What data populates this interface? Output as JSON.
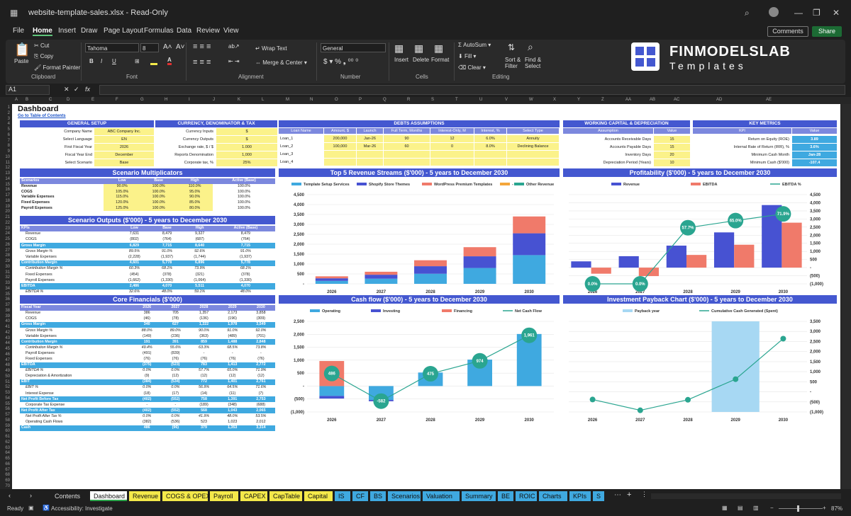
{
  "window": {
    "title": "website-template-sales.xlsx  -  Read-Only",
    "comments": "Comments",
    "share": "Share"
  },
  "menu": [
    "File",
    "Home",
    "Insert",
    "Draw",
    "Page Layout",
    "Formulas",
    "Data",
    "Review",
    "View"
  ],
  "ribbon": {
    "cut": "Cut",
    "copy": "Copy",
    "format_painter": "Format Painter",
    "paste": "Paste",
    "clipboard": "Clipboard",
    "font_name": "Tahoma",
    "font_size": "8",
    "font": "Font",
    "wrap_text": "Wrap Text",
    "merge_center": "Merge & Center",
    "alignment": "Alignment",
    "number_format": "General",
    "number": "Number",
    "insert": "Insert",
    "delete": "Delete",
    "format": "Format",
    "cells": "Cells",
    "autosum": "AutoSum",
    "fill": "Fill",
    "clear": "Clear",
    "sort_filter": "Sort & Filter",
    "find_select": "Find & Select",
    "editing": "Editing",
    "logo_line1": "FINMODELSLAB",
    "logo_line2": "Templates"
  },
  "formula_bar": {
    "cell_ref": "A1",
    "fx": "fx"
  },
  "columns": [
    "A",
    "B",
    "C",
    "D",
    "E",
    "F",
    "G",
    "H",
    "I",
    "J",
    "K",
    "L",
    "M",
    "N",
    "O",
    "P",
    "Q",
    "R",
    "S",
    "T",
    "U",
    "V",
    "W",
    "X",
    "Y",
    "Z",
    "AA",
    "AB",
    "AC",
    "AD",
    "AE"
  ],
  "sheet": {
    "title": "Dashboard",
    "toc": "Go to Table of Contents",
    "general": {
      "header": "GENERAL SETUP",
      "rows": [
        [
          "Company Name",
          "ABC Company Inc."
        ],
        [
          "Select Language",
          "EN"
        ],
        [
          "First Fiscal Year",
          "2026"
        ],
        [
          "Fiscal Year End",
          "December"
        ],
        [
          "Select Scenario",
          "Base"
        ]
      ]
    },
    "currency": {
      "header": "CURRENCY, DENOMINATOR & TAX",
      "rows": [
        [
          "Currency Inputs",
          "$"
        ],
        [
          "Currency Outputs",
          "$"
        ],
        [
          "Exchange rate, $ / $",
          "1.000"
        ],
        [
          "Reports Denomination",
          "1,000"
        ],
        [
          "Corporate tax, %",
          "25%"
        ]
      ]
    },
    "debts": {
      "header": "DEBTS ASSUMPTIONS",
      "cols": [
        "Loan Name",
        "Amount, $",
        "Launch",
        "Full Term, Months",
        "Interest-Only, M",
        "Interest, %",
        "Select Type"
      ],
      "rows": [
        [
          "Loan_1",
          "200,000",
          "Jan-26",
          "90",
          "12",
          "6.0%",
          "Annuity"
        ],
        [
          "Loan_2",
          "100,000",
          "Mar-26",
          "60",
          "0",
          "8.0%",
          "Declining Balance"
        ],
        [
          "Loan_3",
          "",
          "",
          "",
          "",
          "",
          ""
        ],
        [
          "Loan_4",
          "",
          "",
          "",
          "",
          "",
          ""
        ]
      ]
    },
    "wc": {
      "header": "WORKING CAPITAL & DEPRECIATION",
      "cols": [
        "Assumption",
        "Value"
      ],
      "rows": [
        [
          "Accounts Receivable Days",
          "15"
        ],
        [
          "Accounts Payable Days",
          "15"
        ],
        [
          "Inventory Days",
          "20"
        ],
        [
          "Depreciation Period (Years)",
          "10"
        ]
      ]
    },
    "kpi": {
      "header": "KEY METRICS",
      "cols": [
        "KPI",
        "Value"
      ],
      "rows": [
        [
          "Return on Equity (ROE)",
          "3.89"
        ],
        [
          "Internal Rate of Return (IRR), %",
          "3.6%"
        ],
        [
          "Minimum Cash Month",
          "Jan-28"
        ],
        [
          "Minimum Cash ($'000)",
          "-107.4"
        ]
      ]
    },
    "scen_mult": {
      "header": "Scenario Multiplicators",
      "cols": [
        "Scenarios",
        "Low",
        "Base",
        "High",
        "Active (Base)"
      ],
      "rows": [
        [
          "Revenue",
          "90.0%",
          "100.0%",
          "110.0%",
          "100.0%"
        ],
        [
          "COGS",
          "105.0%",
          "100.0%",
          "95.0%",
          "100.0%"
        ],
        [
          "Variable Expenses",
          "115.0%",
          "100.0%",
          "90.0%",
          "100.0%"
        ],
        [
          "Fixed Expenses",
          "120.0%",
          "100.0%",
          "85.0%",
          "100.0%"
        ],
        [
          "Payroll Expenses",
          "125.0%",
          "100.0%",
          "80.0%",
          "100.0%"
        ]
      ]
    },
    "scen_out": {
      "header": "Scenario Outputs ($'000) - 5 years to December 2030",
      "cols": [
        "KPIs",
        "Low",
        "Base",
        "High",
        "Active (Base)"
      ],
      "rows": [
        [
          "Revenue",
          "7,631",
          "8,479",
          "9,327",
          "8,479",
          ""
        ],
        [
          "COGS",
          "(802)",
          "(764)",
          "(687)",
          "(764)",
          ""
        ],
        [
          "Gross Margin",
          "6,829",
          "7,715",
          "8,640",
          "7,715",
          "hl"
        ],
        [
          "Gross Margin %",
          "89.5%",
          "91.0%",
          "92.6%",
          "91.0%",
          "it"
        ],
        [
          "Variable Expenses",
          "(2,228)",
          "(1,937)",
          "(1,744)",
          "(1,937)",
          ""
        ],
        [
          "Contribution Margin",
          "4,601",
          "5,778",
          "6,896",
          "5,778",
          "hl"
        ],
        [
          "Contribution Margin %",
          "60.3%",
          "68.1%",
          "73.9%",
          "68.1%",
          "it"
        ],
        [
          "Fixed Expenses",
          "(454)",
          "(378)",
          "(321)",
          "(378)",
          ""
        ],
        [
          "Payroll Expenses",
          "(1,662)",
          "(1,330)",
          "(1,064)",
          "(1,330)",
          ""
        ],
        [
          "EBITDA",
          "2,486",
          "4,070",
          "5,511",
          "4,070",
          "hl"
        ],
        [
          "EBITDA %",
          "32.6%",
          "48.0%",
          "59.1%",
          "48.0%",
          "it"
        ]
      ]
    },
    "core": {
      "header": "Core Financials ($'000)",
      "cols": [
        "Fiscal Year",
        "2026",
        "2027",
        "2028",
        "2029",
        "2030"
      ],
      "rows": [
        [
          "Revenue",
          "386",
          "705",
          "1,357",
          "2,173",
          "3,858",
          ""
        ],
        [
          "COGS",
          "(46)",
          "(78)",
          "(136)",
          "(196)",
          "(309)",
          ""
        ],
        [
          "Gross Margin",
          "340",
          "627",
          "1,222",
          "1,978",
          "3,549",
          "hl"
        ],
        [
          "Gross Margin %",
          "88.0%",
          "89.0%",
          "90.0%",
          "91.0%",
          "92.0%",
          "it"
        ],
        [
          "Variable Expenses",
          "(149)",
          "(236)",
          "(363)",
          "(489)",
          "(701)",
          ""
        ],
        [
          "Contribution Margin",
          "191",
          "391",
          "859",
          "1,488",
          "2,848",
          "hl"
        ],
        [
          "Contribution Margin %",
          "49.4%",
          "55.6%",
          "63.3%",
          "68.5%",
          "73.8%",
          "it"
        ],
        [
          "Payroll Expenses",
          "(491)",
          "(839)",
          "-",
          "-",
          "-",
          ""
        ],
        [
          "Fixed Expenses",
          "(76)",
          "(76)",
          "(76)",
          "(76)",
          "(76)",
          ""
        ],
        [
          "EBITDA",
          "(375)",
          "(523)",
          "783",
          "1,413",
          "2,772",
          "hl"
        ],
        [
          "EBITDA %",
          "0.0%",
          "0.0%",
          "57.7%",
          "65.0%",
          "71.9%",
          "it"
        ],
        [
          "Depreciation & Amortization",
          "(9)",
          "(12)",
          "(12)",
          "(12)",
          "(12)",
          ""
        ],
        [
          "EBIT",
          "(384)",
          "(534)",
          "772",
          "1,401",
          "2,761",
          "hl"
        ],
        [
          "EBIT %",
          "0.0%",
          "0.0%",
          "56.9%",
          "64.5%",
          "71.6%",
          "it"
        ],
        [
          "Interest Expense",
          "(18)",
          "(17)",
          "(14)",
          "(11)",
          "(7)",
          ""
        ],
        [
          "Net Profit Before Tax",
          "(402)",
          "(552)",
          "758",
          "1,391",
          "2,753",
          "hl"
        ],
        [
          "Corporate Tax Expense",
          "-",
          "-",
          "(189)",
          "(348)",
          "(688)",
          ""
        ],
        [
          "Net Profit After Tax",
          "(402)",
          "(552)",
          "568",
          "1,043",
          "2,065",
          "hl"
        ],
        [
          "Net Profit After Tax %",
          "0.0%",
          "0.0%",
          "41.9%",
          "48.0%",
          "53.5%",
          "it"
        ],
        [
          "Operating Cash Flows",
          "(382)",
          "(536)",
          "523",
          "1,023",
          "2,012",
          ""
        ],
        [
          "Cash",
          "486",
          "(96)",
          "379",
          "1,353",
          "3,314",
          "hl"
        ]
      ]
    }
  },
  "chart_data": [
    {
      "type": "bar",
      "title": "Top 5 Revenue Streams ($'000) - 5 years to December 2030",
      "categories": [
        "2026",
        "2027",
        "2028",
        "2029",
        "2030"
      ],
      "stacked": true,
      "series": [
        {
          "name": "Template Setup Services",
          "color": "#3fa9e0",
          "values": [
            150,
            260,
            510,
            800,
            1450
          ]
        },
        {
          "name": "Shopify Store Themes",
          "color": "#4752d2",
          "values": [
            130,
            200,
            380,
            590,
            1100
          ]
        },
        {
          "name": "WordPress Premium Templates",
          "color": "#f07a6a",
          "values": [
            100,
            150,
            300,
            460,
            850
          ]
        },
        {
          "name": "-",
          "color": "#f4a63a",
          "values": [
            0,
            0,
            0,
            0,
            0
          ]
        },
        {
          "name": "Other Revenue",
          "color": "#2aa590",
          "values": [
            0,
            0,
            0,
            0,
            0
          ]
        }
      ],
      "yticks": [
        "-",
        "500",
        "1,000",
        "1,500",
        "2,000",
        "2,500",
        "3,000",
        "3,500",
        "4,000",
        "4,500"
      ],
      "ylim": [
        0,
        4500
      ]
    },
    {
      "type": "bar",
      "title": "Profitability ($'000) - 5 years to December 2030",
      "categories": [
        "2026",
        "2027",
        "2028",
        "2029",
        "2030"
      ],
      "series": [
        {
          "name": "Revenue",
          "color": "#4752d2",
          "values": [
            386,
            705,
            1357,
            2173,
            3858
          ]
        },
        {
          "name": "EBITDA",
          "color": "#f07a6a",
          "values": [
            -375,
            -523,
            783,
            1413,
            2772
          ]
        },
        {
          "name": "EBITDA %",
          "color": "#2aa590",
          "type": "line",
          "values": [
            0,
            0,
            57.7,
            65.0,
            71.9
          ],
          "labels": [
            "0.0%",
            "0.0%",
            "57.7%",
            "65.0%",
            "71.9%"
          ]
        }
      ],
      "yticks": [
        "(1,000)",
        "(500)",
        "-",
        "500",
        "1,000",
        "1,500",
        "2,000",
        "2,500",
        "3,000",
        "3,500",
        "4,000",
        "4,500"
      ],
      "ylim": [
        -1000,
        4500
      ]
    },
    {
      "type": "bar",
      "title": "Cash flow ($'000) - 5 years to December 2030",
      "categories": [
        "2026",
        "2027",
        "2028",
        "2029",
        "2030"
      ],
      "series": [
        {
          "name": "Operating",
          "color": "#3fa9e0",
          "values": [
            -382,
            -536,
            523,
            1023,
            2012
          ]
        },
        {
          "name": "Investing",
          "color": "#4752d2",
          "values": [
            -100,
            -50,
            0,
            0,
            0
          ]
        },
        {
          "name": "Financing",
          "color": "#f07a6a",
          "values": [
            968,
            0,
            0,
            0,
            0
          ]
        },
        {
          "name": "Net Cash Flow",
          "color": "#2aa590",
          "type": "line",
          "values": [
            486,
            -582,
            475,
            974,
            1961
          ],
          "labels": [
            "486",
            "-582",
            "475",
            "974",
            "1,961"
          ]
        }
      ],
      "yticks": [
        "(1,000)",
        "(500)",
        "-",
        "500",
        "1,000",
        "1,500",
        "2,000",
        "2,500"
      ],
      "ylim": [
        -1000,
        2500
      ]
    },
    {
      "type": "bar",
      "title": "Investment Payback Chart ($'000) - 5 years to December 2030",
      "categories": [
        "2026",
        "2027",
        "2028",
        "2029",
        "2030"
      ],
      "series": [
        {
          "name": "Payback year",
          "color": "#a7d8f3",
          "values": [
            0,
            0,
            0,
            1,
            0
          ]
        },
        {
          "name": "Cumulative Cash Generated (Spent)",
          "color": "#2aa590",
          "type": "line",
          "values": [
            -382,
            -918,
            -395,
            628,
            2640
          ]
        }
      ],
      "yticks": [
        "(1,000)",
        "(500)",
        "-",
        "500",
        "1,000",
        "1,500",
        "2,000",
        "2,500",
        "3,000",
        "3,500"
      ],
      "ylim": [
        -1000,
        3500
      ]
    }
  ],
  "tabs": [
    {
      "label": "Contents",
      "color": ""
    },
    {
      "label": "Dashboard",
      "color": "#ffffff"
    },
    {
      "label": "Revenue",
      "color": "#f4e94a"
    },
    {
      "label": "COGS & OPEX",
      "color": "#f4e94a"
    },
    {
      "label": "Payroll",
      "color": "#f4e94a"
    },
    {
      "label": "CAPEX",
      "color": "#f4e94a"
    },
    {
      "label": "CapTable",
      "color": "#f4e94a"
    },
    {
      "label": "Capital",
      "color": "#f4e94a"
    },
    {
      "label": "IS",
      "color": "#3fa9e0"
    },
    {
      "label": "CF",
      "color": "#3fa9e0"
    },
    {
      "label": "BS",
      "color": "#3fa9e0"
    },
    {
      "label": "Scenarios",
      "color": "#3fa9e0"
    },
    {
      "label": "Valuation",
      "color": "#3fa9e0"
    },
    {
      "label": "Summary",
      "color": "#3fa9e0"
    },
    {
      "label": "BE",
      "color": "#3fa9e0"
    },
    {
      "label": "ROIC",
      "color": "#3fa9e0"
    },
    {
      "label": "Charts",
      "color": "#3fa9e0"
    },
    {
      "label": "KPIs",
      "color": "#3fa9e0"
    },
    {
      "label": "S",
      "color": "#3fa9e0"
    }
  ],
  "status": {
    "ready": "Ready",
    "accessibility": "Accessibility: Investigate",
    "zoom": "87%"
  }
}
